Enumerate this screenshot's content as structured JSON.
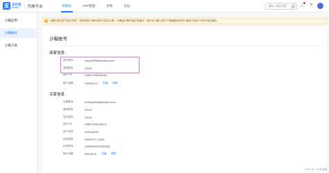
{
  "header": {
    "brand_name": "支付宝",
    "brand_sub": "ALIPAY",
    "platform": "开放平台",
    "nav": [
      "控制台",
      "APP管理",
      "文档",
      "论坛"
    ],
    "active_nav": "控制台",
    "search_placeholder": "请输入搜索/搜索",
    "accent": "#1677ff"
  },
  "sidebar": {
    "items": [
      "沙箱应用",
      "沙箱账号",
      "沙箱工具"
    ],
    "active": "沙箱账号"
  },
  "notice": {
    "text": "沙箱环境仅用于接口测试，请勿使用沙箱环境进行真实交易。为确保沙箱环境正常使用，请先在沙箱工具中下载最新版本的沙箱支付宝APP进行测试使用。"
  },
  "card": {
    "title": "沙箱账号",
    "merchant_section": {
      "title": "商家信息",
      "rows": [
        {
          "label": "商户账号",
          "value": "hdmzj2005@sandbox.com"
        },
        {
          "label": "登录密码",
          "value": "111111"
        },
        {
          "label": "商户PID",
          "value": "2088721005136184"
        },
        {
          "label": "账户余额",
          "value": "1000250.57",
          "links": [
            "充值",
            "提现"
          ]
        }
      ]
    },
    "buyer_section": {
      "title": "买家信息",
      "rows": [
        {
          "label": "买家账号",
          "value": "hnxbxq0420@sandbox.com"
        },
        {
          "label": "登录密码",
          "value": "111111"
        },
        {
          "label": "支付密码",
          "value": "111111"
        },
        {
          "label": "用户UID",
          "value": "2088722005138172"
        },
        {
          "label": "用户名称",
          "value": "hnxbxq0420"
        },
        {
          "label": "证件类型",
          "value": "IDENTITY_CARD"
        },
        {
          "label": "证件账号",
          "value": "416598199310080258"
        },
        {
          "label": "账户余额",
          "value": "999749.43",
          "links": [
            "充值",
            "提现"
          ]
        }
      ]
    }
  },
  "watermark": "CSDN @一只学渣猿"
}
